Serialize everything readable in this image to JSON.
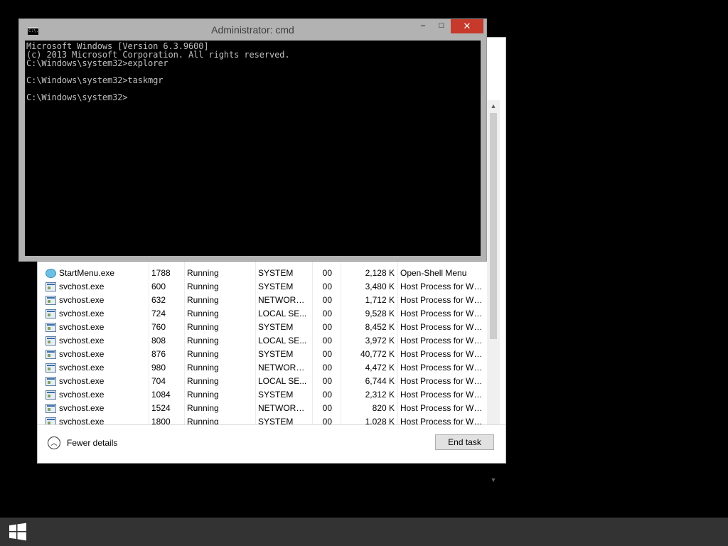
{
  "cmd": {
    "title": "Administrator: cmd",
    "icon": "console-icon",
    "icon_text": "C:\\.",
    "buttons": {
      "minimize": "–",
      "maximize": "□",
      "close": "✕"
    },
    "lines": [
      "Microsoft Windows [Version 6.3.9600]",
      "(c) 2013 Microsoft Corporation. All rights reserved.",
      "C:\\Windows\\system32>explorer",
      "",
      "C:\\Windows\\system32>taskmgr",
      "",
      "C:\\Windows\\system32>"
    ]
  },
  "taskmgr": {
    "rows": [
      {
        "name": "StartMenu.exe",
        "pid": "1788",
        "status": "Running",
        "user": "SYSTEM",
        "cpu": "00",
        "memory": "2,128 K",
        "description": "Open-Shell Menu",
        "icon": "open-shell-icon"
      },
      {
        "name": "svchost.exe",
        "pid": "600",
        "status": "Running",
        "user": "SYSTEM",
        "cpu": "00",
        "memory": "3,480 K",
        "description": "Host Process for Wi...",
        "icon": "service-host-icon"
      },
      {
        "name": "svchost.exe",
        "pid": "632",
        "status": "Running",
        "user": "NETWORK...",
        "cpu": "00",
        "memory": "1,712 K",
        "description": "Host Process for Wi...",
        "icon": "service-host-icon"
      },
      {
        "name": "svchost.exe",
        "pid": "724",
        "status": "Running",
        "user": "LOCAL SE...",
        "cpu": "00",
        "memory": "9,528 K",
        "description": "Host Process for Wi...",
        "icon": "service-host-icon"
      },
      {
        "name": "svchost.exe",
        "pid": "760",
        "status": "Running",
        "user": "SYSTEM",
        "cpu": "00",
        "memory": "8,452 K",
        "description": "Host Process for Wi...",
        "icon": "service-host-icon"
      },
      {
        "name": "svchost.exe",
        "pid": "808",
        "status": "Running",
        "user": "LOCAL SE...",
        "cpu": "00",
        "memory": "3,972 K",
        "description": "Host Process for Wi...",
        "icon": "service-host-icon"
      },
      {
        "name": "svchost.exe",
        "pid": "876",
        "status": "Running",
        "user": "SYSTEM",
        "cpu": "00",
        "memory": "40,772 K",
        "description": "Host Process for Wi...",
        "icon": "service-host-icon"
      },
      {
        "name": "svchost.exe",
        "pid": "980",
        "status": "Running",
        "user": "NETWORK...",
        "cpu": "00",
        "memory": "4,472 K",
        "description": "Host Process for Wi...",
        "icon": "service-host-icon"
      },
      {
        "name": "svchost.exe",
        "pid": "704",
        "status": "Running",
        "user": "LOCAL SE...",
        "cpu": "00",
        "memory": "6,744 K",
        "description": "Host Process for Wi...",
        "icon": "service-host-icon"
      },
      {
        "name": "svchost.exe",
        "pid": "1084",
        "status": "Running",
        "user": "SYSTEM",
        "cpu": "00",
        "memory": "2,312 K",
        "description": "Host Process for Wi...",
        "icon": "service-host-icon"
      },
      {
        "name": "svchost.exe",
        "pid": "1524",
        "status": "Running",
        "user": "NETWORK...",
        "cpu": "00",
        "memory": "820 K",
        "description": "Host Process for Wi...",
        "icon": "service-host-icon"
      },
      {
        "name": "svchost.exe",
        "pid": "1800",
        "status": "Running",
        "user": "SYSTEM",
        "cpu": "00",
        "memory": "1,028 K",
        "description": "Host Process for Wi...",
        "icon": "service-host-icon"
      }
    ],
    "scroll_up": "▲",
    "scroll_down": "▼",
    "fewer_details_label": "Fewer details",
    "fewer_details_icon": "chevron-up-icon",
    "fewer_details_glyph": "︿",
    "end_task_label": "End task"
  },
  "taskbar": {
    "start_icon": "windows-logo-icon"
  },
  "colors": {
    "desktop": "#000000",
    "cmd_frame": "#b2b2b2",
    "close_button": "#c7392b",
    "console_text": "#c0c0c0",
    "taskbar": "#333333"
  }
}
